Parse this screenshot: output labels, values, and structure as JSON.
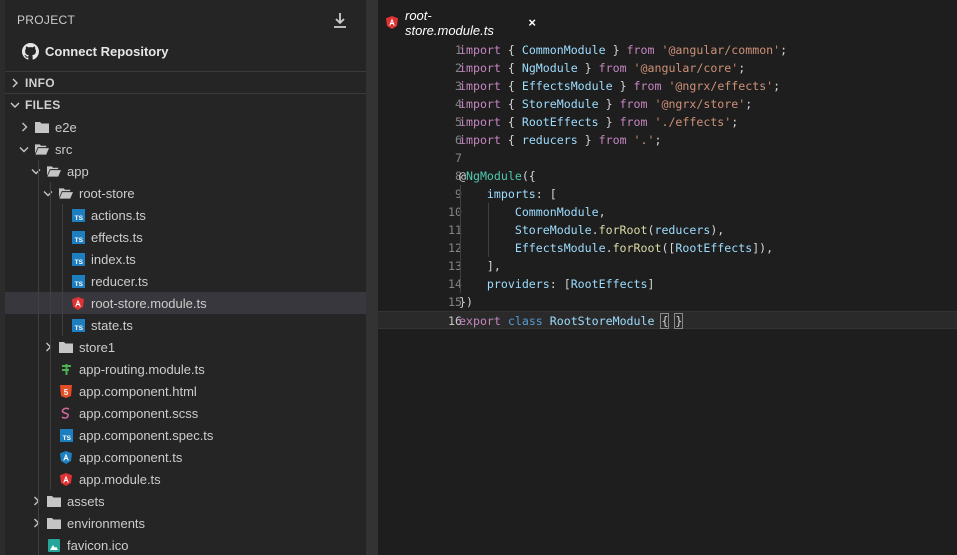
{
  "sidebar": {
    "header": "PROJECT",
    "connect_label": "Connect Repository",
    "sections": {
      "info": "INFO",
      "files": "FILES"
    },
    "tree": [
      {
        "label": "e2e",
        "kind": "folder",
        "depth": 0,
        "expanded": false
      },
      {
        "label": "src",
        "kind": "folder",
        "depth": 0,
        "expanded": true
      },
      {
        "label": "app",
        "kind": "folder",
        "depth": 1,
        "expanded": true
      },
      {
        "label": "root-store",
        "kind": "folder",
        "depth": 2,
        "expanded": true
      },
      {
        "label": "actions.ts",
        "kind": "ts",
        "depth": 3
      },
      {
        "label": "effects.ts",
        "kind": "ts",
        "depth": 3
      },
      {
        "label": "index.ts",
        "kind": "ts",
        "depth": 3
      },
      {
        "label": "reducer.ts",
        "kind": "ts",
        "depth": 3
      },
      {
        "label": "root-store.module.ts",
        "kind": "angular",
        "depth": 3,
        "selected": true
      },
      {
        "label": "state.ts",
        "kind": "ts",
        "depth": 3
      },
      {
        "label": "store1",
        "kind": "folder",
        "depth": 2,
        "expanded": false
      },
      {
        "label": "app-routing.module.ts",
        "kind": "routing",
        "depth": 2
      },
      {
        "label": "app.component.html",
        "kind": "html",
        "depth": 2
      },
      {
        "label": "app.component.scss",
        "kind": "scss",
        "depth": 2
      },
      {
        "label": "app.component.spec.ts",
        "kind": "ts",
        "depth": 2
      },
      {
        "label": "app.component.ts",
        "kind": "angular-blue",
        "depth": 2
      },
      {
        "label": "app.module.ts",
        "kind": "angular",
        "depth": 2
      },
      {
        "label": "assets",
        "kind": "folder",
        "depth": 1,
        "expanded": false
      },
      {
        "label": "environments",
        "kind": "folder",
        "depth": 1,
        "expanded": false
      },
      {
        "label": "favicon.ico",
        "kind": "image",
        "depth": 1
      }
    ]
  },
  "editor": {
    "tab_label": "root-store.module.ts",
    "tab_close": "×",
    "current_line": 16,
    "lines": [
      {
        "n": "1",
        "tokens": [
          [
            "kw",
            "import"
          ],
          [
            "pun",
            " { "
          ],
          [
            "id",
            "CommonModule"
          ],
          [
            "pun",
            " } "
          ],
          [
            "kw",
            "from"
          ],
          [
            "pun",
            " "
          ],
          [
            "str",
            "'@angular/common'"
          ],
          [
            "pun",
            ";"
          ]
        ]
      },
      {
        "n": "2",
        "tokens": [
          [
            "kw",
            "import"
          ],
          [
            "pun",
            " { "
          ],
          [
            "id",
            "NgModule"
          ],
          [
            "pun",
            " } "
          ],
          [
            "kw",
            "from"
          ],
          [
            "pun",
            " "
          ],
          [
            "str",
            "'@angular/core'"
          ],
          [
            "pun",
            ";"
          ]
        ]
      },
      {
        "n": "3",
        "tokens": [
          [
            "kw",
            "import"
          ],
          [
            "pun",
            " { "
          ],
          [
            "id",
            "EffectsModule"
          ],
          [
            "pun",
            " } "
          ],
          [
            "kw",
            "from"
          ],
          [
            "pun",
            " "
          ],
          [
            "str",
            "'@ngrx/effects'"
          ],
          [
            "pun",
            ";"
          ]
        ]
      },
      {
        "n": "4",
        "tokens": [
          [
            "kw",
            "import"
          ],
          [
            "pun",
            " { "
          ],
          [
            "id",
            "StoreModule"
          ],
          [
            "pun",
            " } "
          ],
          [
            "kw",
            "from"
          ],
          [
            "pun",
            " "
          ],
          [
            "str",
            "'@ngrx/store'"
          ],
          [
            "pun",
            ";"
          ]
        ]
      },
      {
        "n": "5",
        "tokens": [
          [
            "kw",
            "import"
          ],
          [
            "pun",
            " { "
          ],
          [
            "id",
            "RootEffects"
          ],
          [
            "pun",
            " } "
          ],
          [
            "kw",
            "from"
          ],
          [
            "pun",
            " "
          ],
          [
            "str",
            "'./effects'"
          ],
          [
            "pun",
            ";"
          ]
        ]
      },
      {
        "n": "6",
        "tokens": [
          [
            "kw",
            "import"
          ],
          [
            "pun",
            " { "
          ],
          [
            "id",
            "reducers"
          ],
          [
            "pun",
            " } "
          ],
          [
            "kw",
            "from"
          ],
          [
            "pun",
            " "
          ],
          [
            "str",
            "'.'"
          ],
          [
            "pun",
            ";"
          ]
        ]
      },
      {
        "n": "7",
        "tokens": []
      },
      {
        "n": "8",
        "tokens": [
          [
            "pun",
            "@"
          ],
          [
            "dec",
            "NgModule"
          ],
          [
            "pun",
            "({"
          ]
        ]
      },
      {
        "n": "9",
        "tokens": [
          [
            "pun",
            "    "
          ],
          [
            "id",
            "imports"
          ],
          [
            "pun",
            ": ["
          ]
        ]
      },
      {
        "n": "10",
        "tokens": [
          [
            "pun",
            "        "
          ],
          [
            "id",
            "CommonModule"
          ],
          [
            "pun",
            ","
          ]
        ]
      },
      {
        "n": "11",
        "tokens": [
          [
            "pun",
            "        "
          ],
          [
            "id",
            "StoreModule"
          ],
          [
            "pun",
            "."
          ],
          [
            "fn",
            "forRoot"
          ],
          [
            "pun",
            "("
          ],
          [
            "id",
            "reducers"
          ],
          [
            "pun",
            "),"
          ]
        ]
      },
      {
        "n": "12",
        "tokens": [
          [
            "pun",
            "        "
          ],
          [
            "id",
            "EffectsModule"
          ],
          [
            "pun",
            "."
          ],
          [
            "fn",
            "forRoot"
          ],
          [
            "pun",
            "(["
          ],
          [
            "id",
            "RootEffects"
          ],
          [
            "pun",
            "]),"
          ]
        ]
      },
      {
        "n": "13",
        "tokens": [
          [
            "pun",
            "    ],"
          ]
        ]
      },
      {
        "n": "14",
        "tokens": [
          [
            "pun",
            "    "
          ],
          [
            "id",
            "providers"
          ],
          [
            "pun",
            ": ["
          ],
          [
            "id",
            "RootEffects"
          ],
          [
            "pun",
            "]"
          ]
        ]
      },
      {
        "n": "15",
        "tokens": [
          [
            "pun",
            "})"
          ]
        ]
      },
      {
        "n": "16",
        "tokens": [
          [
            "kw",
            "export"
          ],
          [
            "pun",
            " "
          ],
          [
            "kw2",
            "class"
          ],
          [
            "pun",
            " "
          ],
          [
            "id",
            "RootStoreModule"
          ],
          [
            "pun",
            " "
          ],
          [
            "brace",
            "{"
          ],
          [
            "pun",
            " "
          ],
          [
            "brace",
            "}"
          ]
        ]
      }
    ]
  },
  "colors": {
    "ts": "#1e7fc0",
    "angular": "#dd3333",
    "angular_blue": "#1e7fc0",
    "html": "#e44d26",
    "scss": "#cd6799",
    "routing": "#4caf50",
    "image": "#26a69a",
    "folder": "#c5c5c5"
  }
}
